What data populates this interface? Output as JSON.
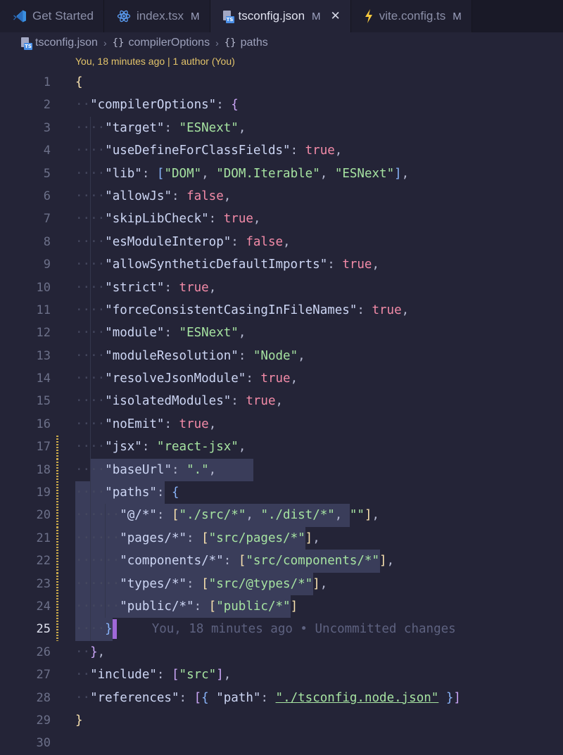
{
  "tabs": [
    {
      "label": "Get Started",
      "icon": "vscode-icon",
      "modified": ""
    },
    {
      "label": "index.tsx",
      "icon": "react-icon",
      "modified": "M"
    },
    {
      "label": "tsconfig.json",
      "icon": "ts-config-icon",
      "modified": "M",
      "active": true
    },
    {
      "label": "vite.config.ts",
      "icon": "lightning-icon",
      "modified": "M"
    }
  ],
  "breadcrumb": {
    "file": "tsconfig.json",
    "segments": [
      "compilerOptions",
      "paths"
    ],
    "brace": "{}"
  },
  "codelens": "You, 18 minutes ago | 1 author (You)",
  "blame": "You, 18 minutes ago • Uncommitted changes",
  "current_line": 25,
  "modified_lines": [
    17,
    18,
    19,
    20,
    21,
    22,
    23,
    24,
    25
  ],
  "lines": [
    {
      "n": "1",
      "indent": 0,
      "tokens": [
        [
          "{",
          "b1"
        ]
      ]
    },
    {
      "n": "2",
      "indent": 1,
      "tokens": [
        [
          "\"compilerOptions\"",
          "key"
        ],
        [
          ": ",
          "p"
        ],
        [
          "{",
          "b2"
        ]
      ]
    },
    {
      "n": "3",
      "indent": 2,
      "tokens": [
        [
          "\"target\"",
          "key"
        ],
        [
          ": ",
          "p"
        ],
        [
          "\"ESNext\"",
          "str"
        ],
        [
          ",",
          "p"
        ]
      ]
    },
    {
      "n": "4",
      "indent": 2,
      "tokens": [
        [
          "\"useDefineForClassFields\"",
          "key"
        ],
        [
          ": ",
          "p"
        ],
        [
          "true",
          "kw"
        ],
        [
          ",",
          "p"
        ]
      ]
    },
    {
      "n": "5",
      "indent": 2,
      "tokens": [
        [
          "\"lib\"",
          "key"
        ],
        [
          ": ",
          "p"
        ],
        [
          "[",
          "b3"
        ],
        [
          "\"DOM\"",
          "str"
        ],
        [
          ", ",
          "p"
        ],
        [
          "\"DOM.Iterable\"",
          "str"
        ],
        [
          ", ",
          "p"
        ],
        [
          "\"ESNext\"",
          "str"
        ],
        [
          "]",
          "b3"
        ],
        [
          ",",
          "p"
        ]
      ]
    },
    {
      "n": "6",
      "indent": 2,
      "tokens": [
        [
          "\"allowJs\"",
          "key"
        ],
        [
          ": ",
          "p"
        ],
        [
          "false",
          "kw"
        ],
        [
          ",",
          "p"
        ]
      ]
    },
    {
      "n": "7",
      "indent": 2,
      "tokens": [
        [
          "\"skipLibCheck\"",
          "key"
        ],
        [
          ": ",
          "p"
        ],
        [
          "true",
          "kw"
        ],
        [
          ",",
          "p"
        ]
      ]
    },
    {
      "n": "8",
      "indent": 2,
      "tokens": [
        [
          "\"esModuleInterop\"",
          "key"
        ],
        [
          ": ",
          "p"
        ],
        [
          "false",
          "kw"
        ],
        [
          ",",
          "p"
        ]
      ]
    },
    {
      "n": "9",
      "indent": 2,
      "tokens": [
        [
          "\"allowSyntheticDefaultImports\"",
          "key"
        ],
        [
          ": ",
          "p"
        ],
        [
          "true",
          "kw"
        ],
        [
          ",",
          "p"
        ]
      ]
    },
    {
      "n": "10",
      "indent": 2,
      "tokens": [
        [
          "\"strict\"",
          "key"
        ],
        [
          ": ",
          "p"
        ],
        [
          "true",
          "kw"
        ],
        [
          ",",
          "p"
        ]
      ]
    },
    {
      "n": "11",
      "indent": 2,
      "tokens": [
        [
          "\"forceConsistentCasingInFileNames\"",
          "key"
        ],
        [
          ": ",
          "p"
        ],
        [
          "true",
          "kw"
        ],
        [
          ",",
          "p"
        ]
      ]
    },
    {
      "n": "12",
      "indent": 2,
      "tokens": [
        [
          "\"module\"",
          "key"
        ],
        [
          ": ",
          "p"
        ],
        [
          "\"ESNext\"",
          "str"
        ],
        [
          ",",
          "p"
        ]
      ]
    },
    {
      "n": "13",
      "indent": 2,
      "tokens": [
        [
          "\"moduleResolution\"",
          "key"
        ],
        [
          ": ",
          "p"
        ],
        [
          "\"Node\"",
          "str"
        ],
        [
          ",",
          "p"
        ]
      ]
    },
    {
      "n": "14",
      "indent": 2,
      "tokens": [
        [
          "\"resolveJsonModule\"",
          "key"
        ],
        [
          ": ",
          "p"
        ],
        [
          "true",
          "kw"
        ],
        [
          ",",
          "p"
        ]
      ]
    },
    {
      "n": "15",
      "indent": 2,
      "tokens": [
        [
          "\"isolatedModules\"",
          "key"
        ],
        [
          ": ",
          "p"
        ],
        [
          "true",
          "kw"
        ],
        [
          ",",
          "p"
        ]
      ]
    },
    {
      "n": "16",
      "indent": 2,
      "tokens": [
        [
          "\"noEmit\"",
          "key"
        ],
        [
          ": ",
          "p"
        ],
        [
          "true",
          "kw"
        ],
        [
          ",",
          "p"
        ]
      ]
    },
    {
      "n": "17",
      "indent": 2,
      "tokens": [
        [
          "\"jsx\"",
          "key"
        ],
        [
          ": ",
          "p"
        ],
        [
          "\"react-jsx\"",
          "str"
        ],
        [
          ",",
          "p"
        ]
      ]
    },
    {
      "n": "18",
      "indent": 2,
      "tokens": [
        [
          "\"baseUrl\"",
          "key"
        ],
        [
          ": ",
          "p"
        ],
        [
          "\".\"",
          "str"
        ],
        [
          ",",
          "p"
        ]
      ],
      "sel": [
        2,
        24
      ]
    },
    {
      "n": "19",
      "indent": 2,
      "tokens": [
        [
          "\"paths\"",
          "key"
        ],
        [
          ": ",
          "p"
        ],
        [
          "{",
          "b3"
        ]
      ],
      "sel": [
        0,
        12
      ]
    },
    {
      "n": "20",
      "indent": 3,
      "tokens": [
        [
          "\"@/*\"",
          "key"
        ],
        [
          ": ",
          "p"
        ],
        [
          "[",
          "b4"
        ],
        [
          "\"./src/*\"",
          "str"
        ],
        [
          ", ",
          "p"
        ],
        [
          "\"./dist/*\"",
          "str"
        ],
        [
          ", ",
          "p"
        ],
        [
          "\"\"",
          "str"
        ],
        [
          "]",
          "b4"
        ],
        [
          ",",
          "p"
        ]
      ],
      "sel": [
        0,
        37
      ]
    },
    {
      "n": "21",
      "indent": 3,
      "tokens": [
        [
          "\"pages/*\"",
          "key"
        ],
        [
          ": ",
          "p"
        ],
        [
          "[",
          "b4"
        ],
        [
          "\"src/pages/*\"",
          "str"
        ],
        [
          "]",
          "b4"
        ],
        [
          ",",
          "p"
        ]
      ],
      "sel": [
        0,
        31
      ]
    },
    {
      "n": "22",
      "indent": 3,
      "tokens": [
        [
          "\"components/*\"",
          "key"
        ],
        [
          ": ",
          "p"
        ],
        [
          "[",
          "b4"
        ],
        [
          "\"src/components/*\"",
          "str"
        ],
        [
          "]",
          "b4"
        ],
        [
          ",",
          "p"
        ]
      ],
      "sel": [
        0,
        41
      ]
    },
    {
      "n": "23",
      "indent": 3,
      "tokens": [
        [
          "\"types/*\"",
          "key"
        ],
        [
          ": ",
          "p"
        ],
        [
          "[",
          "b4"
        ],
        [
          "\"src/@types/*\"",
          "str"
        ],
        [
          "]",
          "b4"
        ],
        [
          ",",
          "p"
        ]
      ],
      "sel": [
        0,
        32
      ]
    },
    {
      "n": "24",
      "indent": 3,
      "tokens": [
        [
          "\"public/*\"",
          "key"
        ],
        [
          ": ",
          "p"
        ],
        [
          "[",
          "b4"
        ],
        [
          "\"public/*\"",
          "str"
        ],
        [
          "]",
          "b4"
        ]
      ],
      "sel": [
        0,
        29
      ]
    },
    {
      "n": "25",
      "indent": 2,
      "tokens": [
        [
          "}",
          "b3"
        ]
      ],
      "sel": [
        0,
        5
      ],
      "cursor": 5,
      "blame": true
    },
    {
      "n": "26",
      "indent": 1,
      "tokens": [
        [
          "}",
          "b2"
        ],
        [
          ",",
          "p"
        ]
      ]
    },
    {
      "n": "27",
      "indent": 1,
      "tokens": [
        [
          "\"include\"",
          "key"
        ],
        [
          ": ",
          "p"
        ],
        [
          "[",
          "b2"
        ],
        [
          "\"src\"",
          "str"
        ],
        [
          "]",
          "b2"
        ],
        [
          ",",
          "p"
        ]
      ]
    },
    {
      "n": "28",
      "indent": 1,
      "tokens": [
        [
          "\"references\"",
          "key"
        ],
        [
          ": ",
          "p"
        ],
        [
          "[",
          "b2"
        ],
        [
          "{",
          "b3"
        ],
        [
          " ",
          "p"
        ],
        [
          "\"path\"",
          "key"
        ],
        [
          ": ",
          "p"
        ],
        [
          "\"./tsconfig.node.json\"",
          "strpath"
        ],
        [
          " ",
          "p"
        ],
        [
          "}",
          "b3"
        ],
        [
          "]",
          "b2"
        ]
      ]
    },
    {
      "n": "29",
      "indent": 0,
      "tokens": [
        [
          "}",
          "b1"
        ]
      ]
    },
    {
      "n": "30",
      "indent": 0,
      "tokens": []
    }
  ]
}
